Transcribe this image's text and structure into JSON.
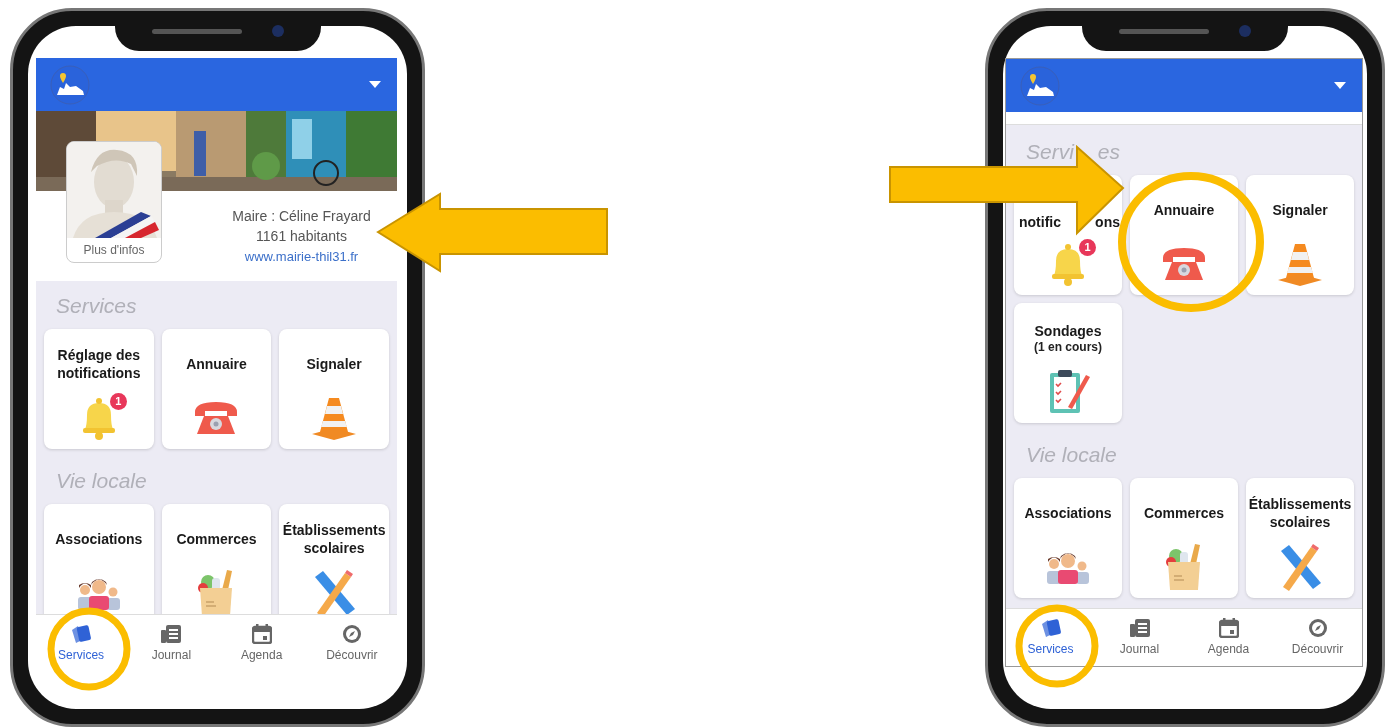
{
  "phones": [
    {
      "profile": {
        "mayor": "Maire : Céline Frayard",
        "population": "1161 habitants",
        "website": "www.mairie-thil31.fr",
        "more_button": "Plus d'infos"
      },
      "sections": [
        {
          "title": "Services",
          "cards": [
            {
              "title": "Réglage des notifications",
              "kind": "bell",
              "badge": "1"
            },
            {
              "title": "Annuaire",
              "kind": "phone"
            },
            {
              "title": "Signaler",
              "kind": "cone"
            }
          ]
        },
        {
          "title": "Vie locale",
          "cards": [
            {
              "title": "Associations",
              "kind": "people"
            },
            {
              "title": "Commerces",
              "kind": "groceries"
            },
            {
              "title": "Établissements scolaires",
              "kind": "ruler"
            }
          ]
        }
      ],
      "nav": [
        {
          "label": "Services",
          "kind": "cards",
          "selected": true
        },
        {
          "label": "Journal",
          "kind": "news",
          "selected": false
        },
        {
          "label": "Agenda",
          "kind": "calendar",
          "selected": false
        },
        {
          "label": "Découvrir",
          "kind": "compass",
          "selected": false
        }
      ]
    },
    {
      "sections": [
        {
          "title_parts": [
            "Servi",
            "es"
          ],
          "cards": [
            {
              "title_parts": [
                "notific",
                "ons"
              ],
              "kind": "bell",
              "badge": "1"
            },
            {
              "title": "Annuaire",
              "kind": "phone"
            },
            {
              "title": "Signaler",
              "kind": "cone"
            },
            {
              "title": "Sondages",
              "subtitle": "(1 en cours)",
              "kind": "clipboard"
            }
          ]
        },
        {
          "title": "Vie locale",
          "cards": [
            {
              "title": "Associations",
              "kind": "people"
            },
            {
              "title": "Commerces",
              "kind": "groceries"
            },
            {
              "title": "Établissements scolaires",
              "kind": "ruler"
            }
          ]
        }
      ],
      "nav": [
        {
          "label": "Services",
          "kind": "cards",
          "selected": true
        },
        {
          "label": "Journal",
          "kind": "news",
          "selected": false
        },
        {
          "label": "Agenda",
          "kind": "calendar",
          "selected": false
        },
        {
          "label": "Découvrir",
          "kind": "compass",
          "selected": false
        }
      ]
    }
  ]
}
